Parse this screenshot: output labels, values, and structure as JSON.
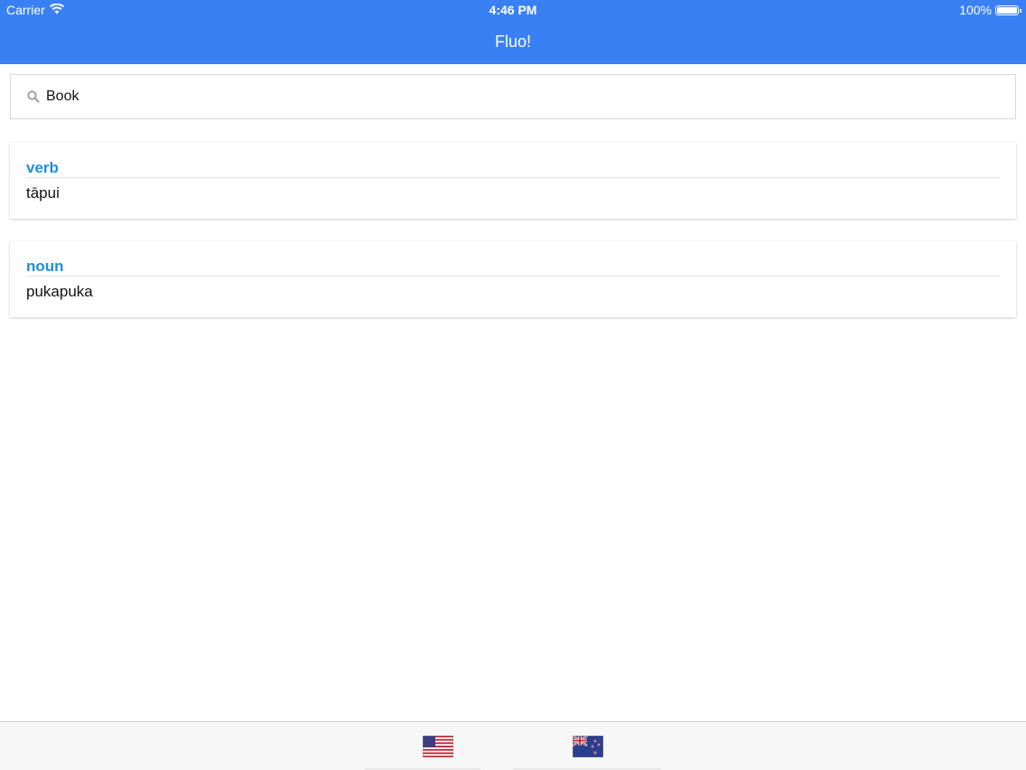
{
  "status_bar": {
    "carrier": "Carrier",
    "time": "4:46 PM",
    "battery": "100%",
    "wifi_icon": "wifi-icon",
    "battery_icon": "battery-icon"
  },
  "nav": {
    "title": "Fluo!"
  },
  "search": {
    "value": "Book",
    "icon": "search-icon"
  },
  "results": [
    {
      "part_of_speech": "verb",
      "translation": "tāpui"
    },
    {
      "part_of_speech": "noun",
      "translation": "pukapuka"
    }
  ],
  "tabbar": {
    "tabs": [
      {
        "icon": "us-flag-icon"
      },
      {
        "icon": "nz-flag-icon"
      }
    ]
  },
  "colors": {
    "nav_background": "#3a80f5",
    "part_of_speech": "#1e8fd6",
    "text": "#111111"
  }
}
